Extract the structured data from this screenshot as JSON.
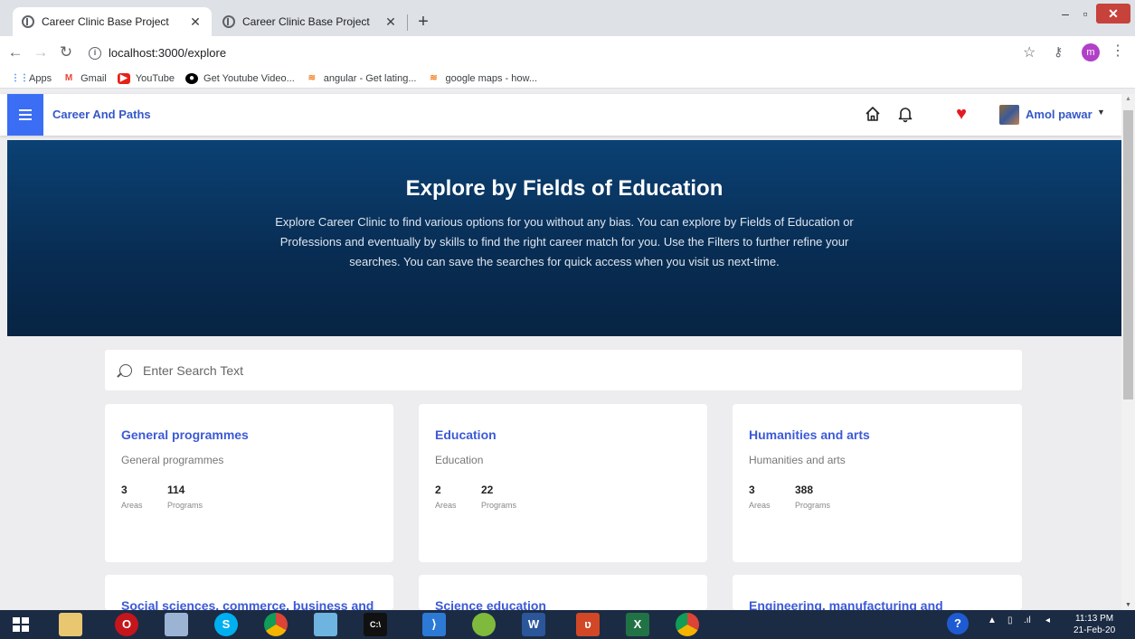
{
  "browser": {
    "tabs": [
      {
        "title": "Career Clinic Base Project",
        "active": true
      },
      {
        "title": "Career Clinic Base Project",
        "active": false
      }
    ],
    "url": "localhost:3000/explore",
    "profile_initial": "m",
    "bookmarks": [
      "Apps",
      "Gmail",
      "YouTube",
      "Get Youtube Video...",
      "angular - Get lating...",
      "google maps - how..."
    ]
  },
  "app": {
    "brand": "Career And Paths",
    "user_name": "Amol pawar",
    "accent_color": "#3b6ef5"
  },
  "hero": {
    "title": "Explore by Fields of Education",
    "description": "Explore Career Clinic to find various options for you without any bias. You can explore by Fields of Education or Professions and eventually by skills to find the right career match for you. Use the Filters to further refine your searches. You can save the searches for quick access when you visit us next-time."
  },
  "search": {
    "placeholder": "Enter Search Text"
  },
  "cards": [
    {
      "title": "General programmes",
      "subtitle": "General programmes",
      "areas": "3",
      "programs": "114"
    },
    {
      "title": "Education",
      "subtitle": "Education",
      "areas": "2",
      "programs": "22"
    },
    {
      "title": "Humanities and arts",
      "subtitle": "Humanities and arts",
      "areas": "3",
      "programs": "388"
    },
    {
      "title": "Social sciences, commerce, business and"
    },
    {
      "title": "Science education"
    },
    {
      "title": "Engineering, manufacturing and"
    }
  ],
  "labels": {
    "areas": "Areas",
    "programs": "Programs"
  },
  "taskbar": {
    "time": "11:13 PM",
    "date": "21-Feb-20"
  }
}
